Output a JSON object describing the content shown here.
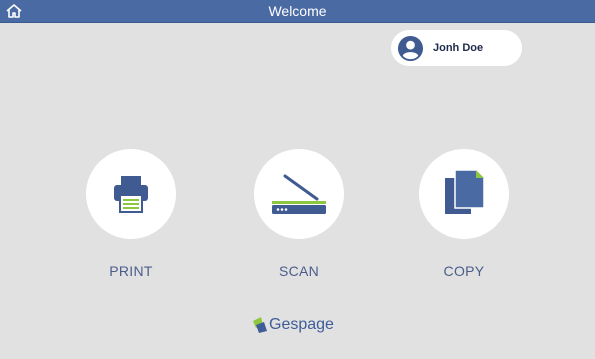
{
  "header": {
    "title": "Welcome",
    "home_icon": "home-icon"
  },
  "user": {
    "name": "Jonh Doe",
    "icon": "user-avatar-icon"
  },
  "actions": [
    {
      "label": "PRINT",
      "icon": "printer-icon"
    },
    {
      "label": "SCAN",
      "icon": "scanner-icon"
    },
    {
      "label": "COPY",
      "icon": "copy-documents-icon"
    }
  ],
  "brand": {
    "name": "Gespage",
    "icon": "gespage-logo-icon"
  },
  "colors": {
    "header_bg": "#4a6aa3",
    "page_bg": "#e1e1e1",
    "icon_blue": "#3f5b92",
    "accent_green": "#8dc63f",
    "label_text": "#4a5d8a"
  }
}
